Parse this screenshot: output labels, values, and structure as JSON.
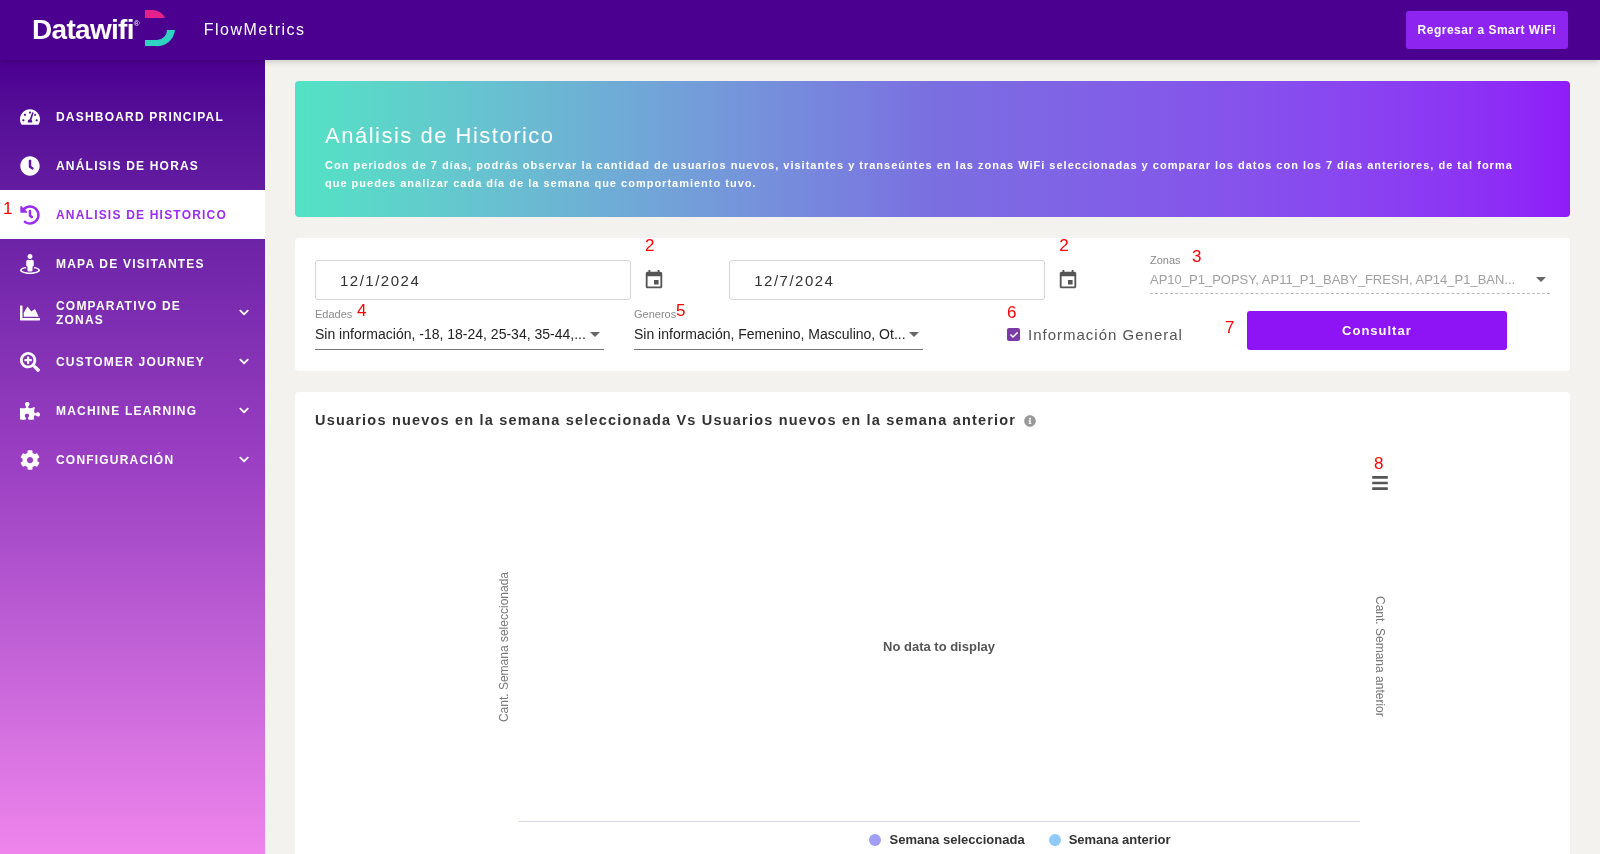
{
  "header": {
    "logo_text": "Datawifi",
    "logo_mark": "®",
    "app_name": "FlowMetrics",
    "back_button": "Regresar a Smart WiFi"
  },
  "sidebar": {
    "items": [
      {
        "label": "DASHBOARD PRINCIPAL",
        "selected": false,
        "expandable": false
      },
      {
        "label": "ANÁLISIS DE HORAS",
        "selected": false,
        "expandable": false
      },
      {
        "label": "ANALISIS DE HISTORICO",
        "selected": true,
        "expandable": false,
        "annotation": "1"
      },
      {
        "label": "MAPA DE VISITANTES",
        "selected": false,
        "expandable": false
      },
      {
        "label": "COMPARATIVO DE ZONAS",
        "selected": false,
        "expandable": true
      },
      {
        "label": "CUSTOMER JOURNEY",
        "selected": false,
        "expandable": true
      },
      {
        "label": "MACHINE LEARNING",
        "selected": false,
        "expandable": true
      },
      {
        "label": "CONFIGURACIÓN",
        "selected": false,
        "expandable": true
      }
    ]
  },
  "banner": {
    "title": "Análisis de Historico",
    "description": "Con periodos de 7 días, podrás observar la cantidad de usuarios nuevos, visitantes y transeúntes en las zonas WiFi seleccionadas y comparar los datos con los 7 días anteriores, de tal forma que puedes analizar cada día de la semana que comportamiento tuvo."
  },
  "filters": {
    "start_date": {
      "value": "12/1/2024",
      "annotation": "2"
    },
    "end_date": {
      "value": "12/7/2024",
      "annotation": "2"
    },
    "zonas": {
      "label": "Zonas",
      "value": "AP10_P1_POPSY, AP11_P1_BABY_FRESH, AP14_P1_BAN...",
      "annotation": "3"
    },
    "edades": {
      "label": "Edades",
      "value": "Sin información, -18, 18-24, 25-34, 35-44,...",
      "annotation": "4"
    },
    "generos": {
      "label": "Generos",
      "value": "Sin información, Femenino, Masculino, Ot...",
      "annotation": "5"
    },
    "general_info": {
      "label": "Información General",
      "checked": true,
      "annotation": "6"
    },
    "submit": {
      "label": "Consultar",
      "annotation": "7"
    }
  },
  "chart": {
    "title": "Usuarios nuevos en la semana seleccionada Vs Usuarios nuevos en la semana anterior",
    "menu_annotation": "8",
    "left_axis_label": "Cant. Semana seleccionada",
    "right_axis_label": "Cant. Semana anterior",
    "empty_message": "No data to display",
    "legend": [
      {
        "label": "Semana seleccionada",
        "color": "#9f9ff6"
      },
      {
        "label": "Semana anterior",
        "color": "#8ecbf8"
      }
    ]
  }
}
